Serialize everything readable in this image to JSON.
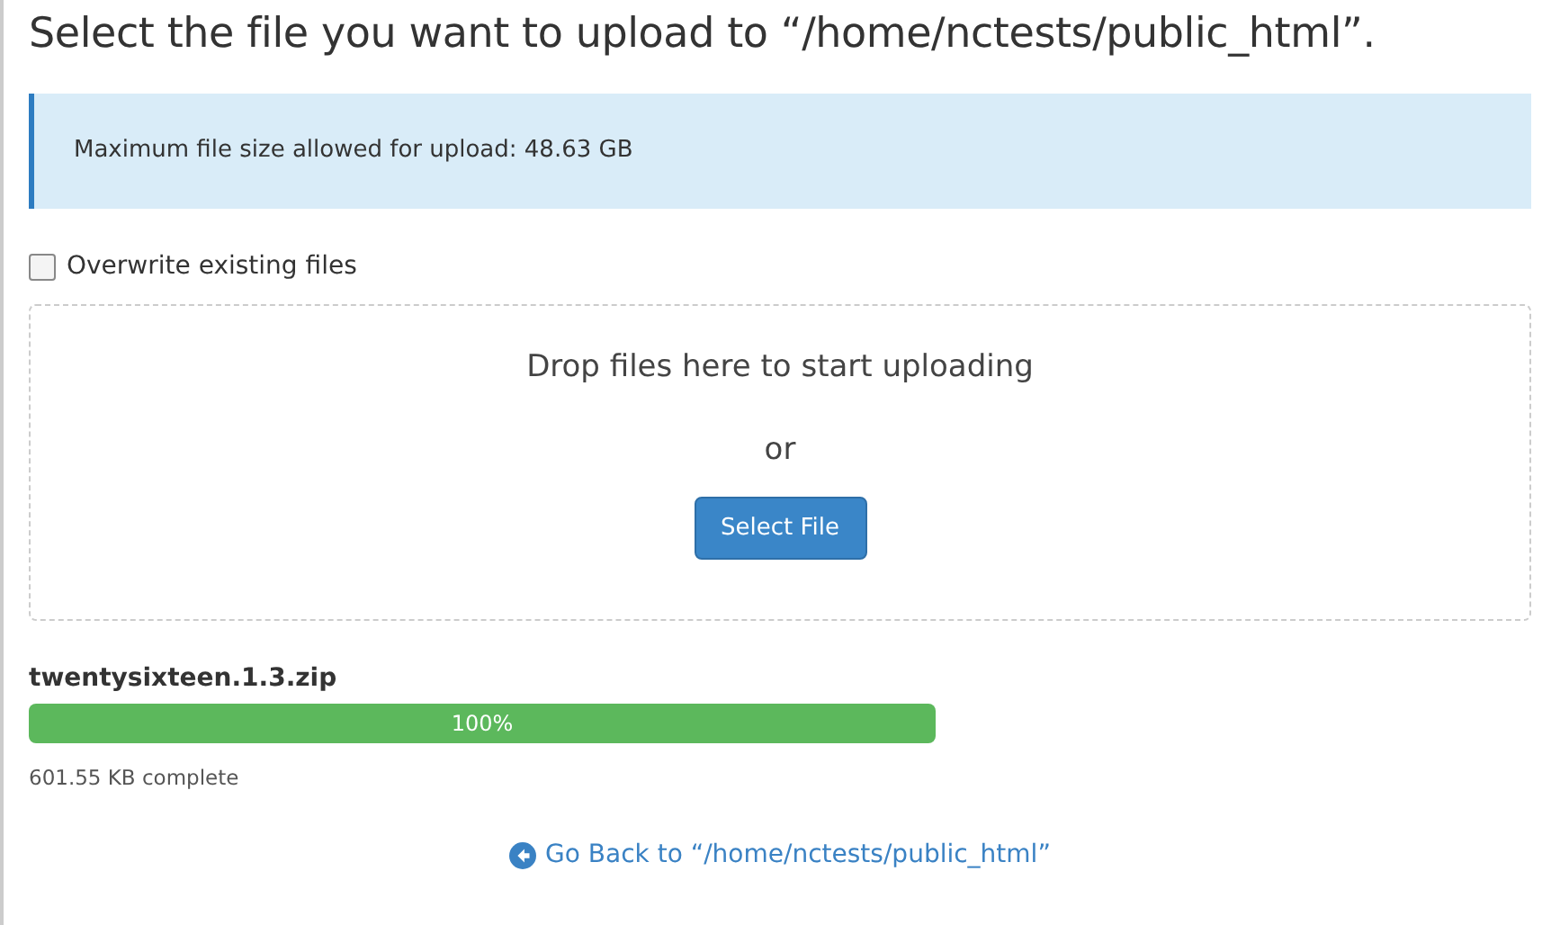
{
  "title": "Select the file you want to upload to “/home/nctests/public_html”.",
  "info": "Maximum file size allowed for upload: 48.63 GB",
  "overwrite": {
    "label": "Overwrite existing files",
    "checked": false
  },
  "dropzone": {
    "text": "Drop files here to start uploading",
    "or": "or",
    "button": "Select File"
  },
  "uploads": [
    {
      "name": "twentysixteen.1.3.zip",
      "level": 1,
      "percent": "100%",
      "status": "601.55 KB complete"
    }
  ],
  "back_link": "Go Back to “/home/nctests/public_html”"
}
